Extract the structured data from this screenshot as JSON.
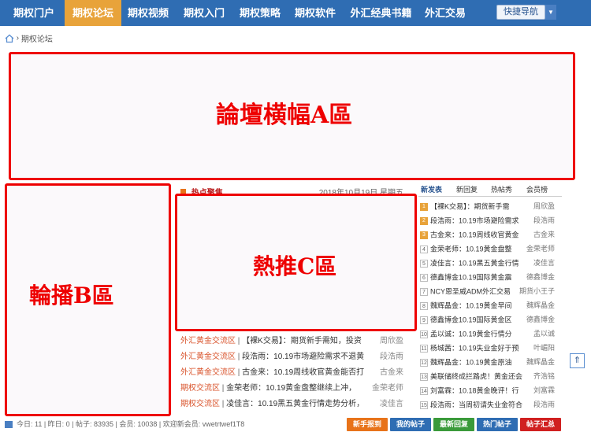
{
  "nav": {
    "items": [
      "期权门户",
      "期权论坛",
      "期权视频",
      "期权入门",
      "期权策略",
      "期权软件",
      "外汇经典书籍",
      "外汇交易"
    ],
    "active_index": 1,
    "quick_nav": "快捷导航"
  },
  "breadcrumb": {
    "current": "期权论坛"
  },
  "zones": {
    "banner_a": "論壇横幅A區",
    "carousel_b": "輪播B區",
    "hotpush_c": "熱推C區"
  },
  "hot": {
    "title": "热点聚焦",
    "date": "2018年10月19日 星期五"
  },
  "forum_rows": [
    {
      "cat": "外汇黄金交流区",
      "text": "【裸K交易】：期货新手需知，投资",
      "author": "周欣盈"
    },
    {
      "cat": "外汇黄金交流区",
      "text": "段浩雨：10.19市场避险需求不退黄",
      "author": "段浩雨"
    },
    {
      "cat": "外汇黄金交流区",
      "text": "古金来：10.19周线收官黄金能否打",
      "author": "古金来"
    },
    {
      "cat": "期权交流区",
      "text": "金荣老师：10.19黄金盘整继续上冲，",
      "author": "金荣老师"
    },
    {
      "cat": "期权交流区",
      "text": "凌佳言：10.19黑五黄金行情走势分析，",
      "author": "凌佳言"
    }
  ],
  "tabs": [
    "新发表",
    "新回复",
    "热帖秀",
    "会员榜"
  ],
  "active_tab": 0,
  "recent": [
    {
      "n": "1",
      "title": "【裸K交易】：期货新手需",
      "author": "周欣盈"
    },
    {
      "n": "2",
      "title": "段浩雨：10.19市场避险需求",
      "author": "段浩雨"
    },
    {
      "n": "3",
      "title": "古金来：10.19周线收官黄金",
      "author": "古金来"
    },
    {
      "n": "4",
      "title": "金荣老师：10.19黄金盘整",
      "author": "金荣老师"
    },
    {
      "n": "5",
      "title": "凌佳言：10.19黑五黄金行情",
      "author": "凌佳言"
    },
    {
      "n": "6",
      "title": "德鑫博金10.19国际黄金震",
      "author": "德鑫博金"
    },
    {
      "n": "7",
      "title": "NCY恩圣威ADM外汇交易",
      "author": "期货小王子"
    },
    {
      "n": "8",
      "title": "魏辉晶金：10.19黄金早间",
      "author": "魏辉晶金"
    },
    {
      "n": "9",
      "title": "德鑫博金10.19国际黄金区",
      "author": "德鑫博金"
    },
    {
      "n": "10",
      "title": "孟以诚：10.19黄金行情分",
      "author": "孟以诚"
    },
    {
      "n": "11",
      "title": "杨城茜：10.19失业金好于预",
      "author": "叶嵋阳"
    },
    {
      "n": "12",
      "title": "魏辉晶金：10.19黄金原油",
      "author": "魏辉晶金"
    },
    {
      "n": "13",
      "title": "美联储终成拦路虎！黄金还会",
      "author": "齐浩铭"
    },
    {
      "n": "14",
      "title": "刘富霖：10.18黄金晚评！行",
      "author": "刘富霖"
    },
    {
      "n": "15",
      "title": "段浩雨：当周初请失业金符合",
      "author": "段浩雨"
    }
  ],
  "side_button": "⇑",
  "stats": {
    "text": "今日: 11  |  昨日: 0  |  帖子: 83935  |  会员: 10038  |  欢迎新会员: vwetrtwef1T8"
  },
  "buttons": [
    {
      "label": "新手报到",
      "color": "#e8731a"
    },
    {
      "label": "我的帖子",
      "color": "#2f6db3"
    },
    {
      "label": "最新回复",
      "color": "#3a9a3a"
    },
    {
      "label": "热门帖子",
      "color": "#2f6db3"
    },
    {
      "label": "帖子汇总",
      "color": "#d02020"
    }
  ]
}
